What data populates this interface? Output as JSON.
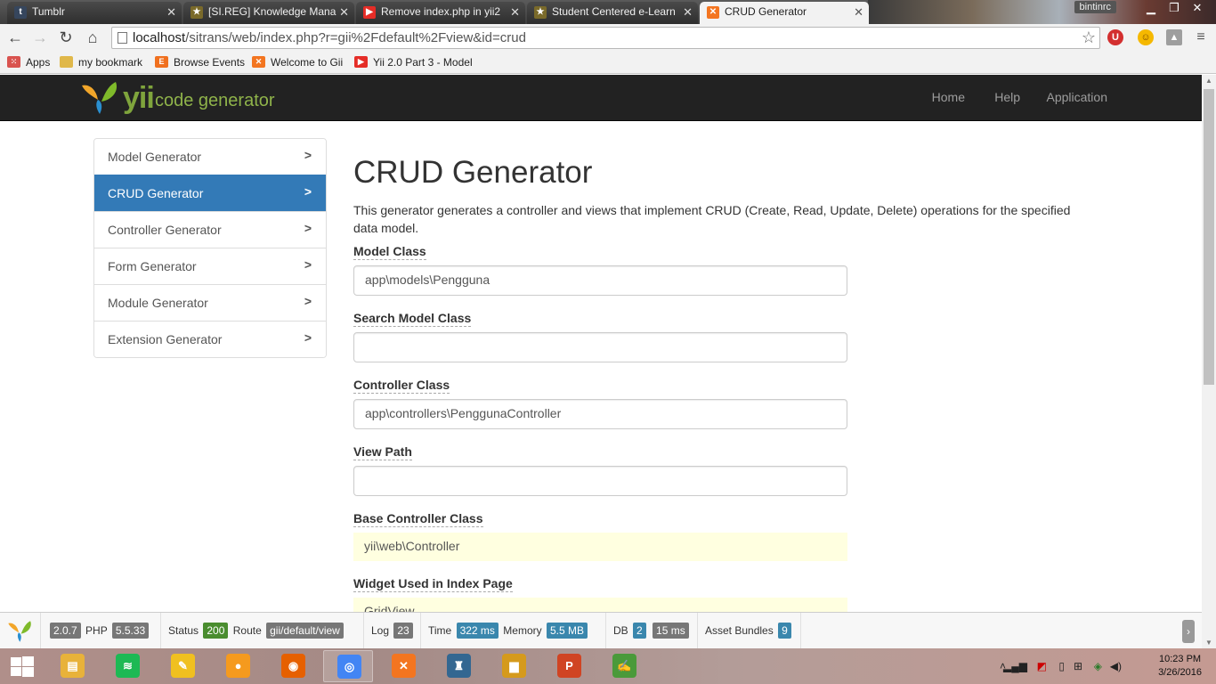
{
  "browser": {
    "tabs": [
      {
        "title": "Tumblr",
        "icon": "tumblr-icon",
        "color": "#36465d"
      },
      {
        "title": "[SI.REG] Knowledge Mana",
        "icon": "scholar-icon",
        "color": "#7a6a2a"
      },
      {
        "title": "Remove index.php in yii2",
        "icon": "youtube-icon",
        "color": "#e52d27"
      },
      {
        "title": "Student Centered e-Learn",
        "icon": "scholar-icon",
        "color": "#7a6a2a"
      },
      {
        "title": "CRUD Generator",
        "icon": "xampp-icon",
        "color": "#f37520"
      }
    ],
    "user": "bintinrc",
    "url_host": "localhost",
    "url_rest": "/sitrans/web/index.php?r=gii%2Fdefault%2Fview&id=crud",
    "bookmarks": [
      {
        "label": "Apps",
        "icon": "apps-grid-icon",
        "color": "#d9534f"
      },
      {
        "label": "my bookmark",
        "icon": "folder-icon",
        "color": "#e0b84a"
      },
      {
        "label": "Browse Events",
        "icon": "eventbrite-icon",
        "color": "#f0701f"
      },
      {
        "label": "Welcome to Gii",
        "icon": "xampp-icon",
        "color": "#f37520"
      },
      {
        "label": "Yii 2.0 Part 3 - Model",
        "icon": "youtube-icon",
        "color": "#e52d27"
      }
    ]
  },
  "navbar": {
    "brand_yii": "yii",
    "brand_text": "code generator",
    "links": [
      "Home",
      "Help",
      "Application"
    ]
  },
  "sidebar": {
    "items": [
      {
        "label": "Model Generator",
        "active": false
      },
      {
        "label": "CRUD Generator",
        "active": true
      },
      {
        "label": "Controller Generator",
        "active": false
      },
      {
        "label": "Form Generator",
        "active": false
      },
      {
        "label": "Module Generator",
        "active": false
      },
      {
        "label": "Extension Generator",
        "active": false
      }
    ]
  },
  "main": {
    "title": "CRUD Generator",
    "description": "This generator generates a controller and views that implement CRUD (Create, Read, Update, Delete) operations for the specified data model.",
    "fields": [
      {
        "label": "Model Class",
        "value": "app\\models\\Pengguna",
        "sticky": false
      },
      {
        "label": "Search Model Class",
        "value": "",
        "sticky": false
      },
      {
        "label": "Controller Class",
        "value": "app\\controllers\\PenggunaController",
        "sticky": false
      },
      {
        "label": "View Path",
        "value": "",
        "sticky": false
      },
      {
        "label": "Base Controller Class",
        "value": "yii\\web\\Controller",
        "sticky": true
      },
      {
        "label": "Widget Used in Index Page",
        "value": "GridView",
        "sticky": true
      }
    ]
  },
  "debug": {
    "yii_version": "2.0.7",
    "php_label": "PHP",
    "php_version": "5.5.33",
    "status_label": "Status",
    "status": "200",
    "route_label": "Route",
    "route": "gii/default/view",
    "log_label": "Log",
    "log": "23",
    "time_label": "Time",
    "time": "322 ms",
    "memory_label": "Memory",
    "memory": "5.5 MB",
    "db_label": "DB",
    "db_count": "2",
    "db_time": "15 ms",
    "assets_label": "Asset Bundles",
    "assets": "9"
  },
  "taskbar": {
    "apps": [
      {
        "name": "file-explorer-icon",
        "glyph": "▤",
        "color": "#e8b23a",
        "running": false
      },
      {
        "name": "spotify-icon",
        "glyph": "≋",
        "color": "#1db954",
        "running": false
      },
      {
        "name": "pen-tool-icon",
        "glyph": "✎",
        "color": "#f0c020",
        "running": false
      },
      {
        "name": "vlc-like-icon",
        "glyph": "●",
        "color": "#f59a1e",
        "running": false
      },
      {
        "name": "firefox-icon",
        "glyph": "◉",
        "color": "#e66000",
        "running": false
      },
      {
        "name": "chrome-icon",
        "glyph": "◎",
        "color": "#4285f4",
        "running": true
      },
      {
        "name": "xampp-icon",
        "glyph": "✕",
        "color": "#f37520",
        "running": false
      },
      {
        "name": "postgres-icon",
        "glyph": "♜",
        "color": "#336791",
        "running": false
      },
      {
        "name": "storage-icon",
        "glyph": "▆",
        "color": "#d59a1c",
        "running": false
      },
      {
        "name": "powerpoint-icon",
        "glyph": "P",
        "color": "#d04423",
        "running": false
      },
      {
        "name": "notepad-icon",
        "glyph": "✍",
        "color": "#4a9a3a",
        "running": false
      }
    ],
    "time": "10:23 PM",
    "date": "3/26/2016"
  }
}
